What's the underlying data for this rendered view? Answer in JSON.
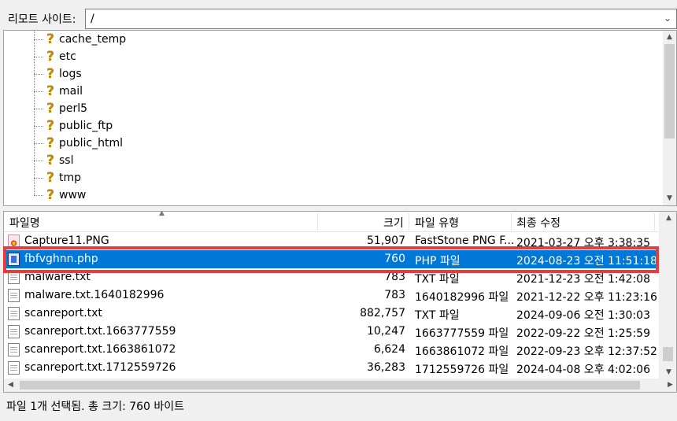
{
  "remote_site": {
    "label": "리모트 사이트:",
    "path": "/"
  },
  "tree": {
    "items": [
      {
        "name": "cache_temp"
      },
      {
        "name": "etc"
      },
      {
        "name": "logs"
      },
      {
        "name": "mail"
      },
      {
        "name": "perl5"
      },
      {
        "name": "public_ftp"
      },
      {
        "name": "public_html"
      },
      {
        "name": "ssl"
      },
      {
        "name": "tmp"
      },
      {
        "name": "www"
      }
    ],
    "item_icon": "unknown-folder-question-icon"
  },
  "file_list": {
    "columns": {
      "name": "파일명",
      "size": "크기",
      "type": "파일 유형",
      "modified": "최종 수정"
    },
    "rows": [
      {
        "icon": "png-image-icon",
        "name": "Capture11.PNG",
        "size": "51,907",
        "type": "FastStone PNG F...",
        "modified": "2021-03-27 오후 3:38:35",
        "selected": false
      },
      {
        "icon": "php-file-icon",
        "name": "fbfvghnn.php",
        "size": "760",
        "type": "PHP 파일",
        "modified": "2024-08-23 오전 11:51:18",
        "selected": true
      },
      {
        "icon": "text-file-icon",
        "name": "malware.txt",
        "size": "783",
        "type": "TXT 파일",
        "modified": "2021-12-23 오전 1:42:08",
        "selected": false
      },
      {
        "icon": "text-file-icon",
        "name": "malware.txt.1640182996",
        "size": "783",
        "type": "1640182996 파일",
        "modified": "2021-12-22 오후 11:23:16",
        "selected": false
      },
      {
        "icon": "text-file-icon",
        "name": "scanreport.txt",
        "size": "882,757",
        "type": "TXT 파일",
        "modified": "2024-09-06 오전 1:30:03",
        "selected": false
      },
      {
        "icon": "text-file-icon",
        "name": "scanreport.txt.1663777559",
        "size": "10,247",
        "type": "1663777559 파일",
        "modified": "2022-09-22 오전 1:25:59",
        "selected": false
      },
      {
        "icon": "text-file-icon",
        "name": "scanreport.txt.1663861072",
        "size": "6,624",
        "type": "1663861072 파일",
        "modified": "2022-09-23 오후 12:37:52",
        "selected": false
      },
      {
        "icon": "text-file-icon",
        "name": "scanreport.txt.1712559726",
        "size": "36,283",
        "type": "1712559726 파일",
        "modified": "2024-04-08 오후 4:02:06",
        "selected": false
      }
    ],
    "highlight_color": "#e63c3c",
    "selection_color": "#0078d7"
  },
  "status": {
    "text": "파일 1개 선택됨. 총 크기: 760 바이트"
  }
}
